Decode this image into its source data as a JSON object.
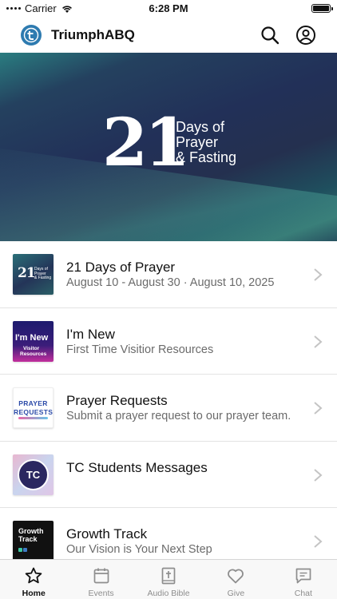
{
  "status_bar": {
    "carrier": "Carrier",
    "time": "6:28 PM"
  },
  "nav": {
    "logo_letter": "t",
    "title": "TriumphABQ"
  },
  "hero": {
    "number": "21",
    "line1": "Days of",
    "line2": "Prayer",
    "line3": "& Fasting",
    "slide_count": 2,
    "active_slide": 1
  },
  "list": {
    "items": [
      {
        "title": "21 Days of Prayer",
        "subtitle": "August 10 - August 30 · August 10, 2025",
        "thumb": {
          "big": "21",
          "small1": "Days of",
          "small2": "Prayer",
          "small3": "& Fasting"
        }
      },
      {
        "title": "I'm New",
        "subtitle": "First Time Visitior Resources",
        "thumb": {
          "line1": "I'm New",
          "line2": "Visitor",
          "line3": "Resources"
        }
      },
      {
        "title": "Prayer Requests",
        "subtitle": "Submit a prayer request to our prayer team.",
        "thumb": {
          "line1": "PRAYER",
          "line2": "REQUESTS"
        }
      },
      {
        "title": "TC Students Messages",
        "subtitle": "",
        "thumb": {
          "line1": "TC"
        }
      },
      {
        "title": "Growth Track",
        "subtitle": "Our Vision is Your Next Step",
        "thumb": {
          "line1": "Growth",
          "line2": "Track"
        }
      }
    ]
  },
  "tabs": [
    {
      "label": "Home",
      "icon": "star-icon",
      "active": true
    },
    {
      "label": "Events",
      "icon": "calendar-icon",
      "active": false
    },
    {
      "label": "Audio Bible",
      "icon": "bible-icon",
      "active": false
    },
    {
      "label": "Give",
      "icon": "heart-icon",
      "active": false
    },
    {
      "label": "Chat",
      "icon": "chat-icon",
      "active": false
    }
  ],
  "colors": {
    "accent": "#2e7bb0",
    "hero_bg": "#223058",
    "tab_active": "#111111",
    "tab_inactive": "#8e8e8e"
  }
}
